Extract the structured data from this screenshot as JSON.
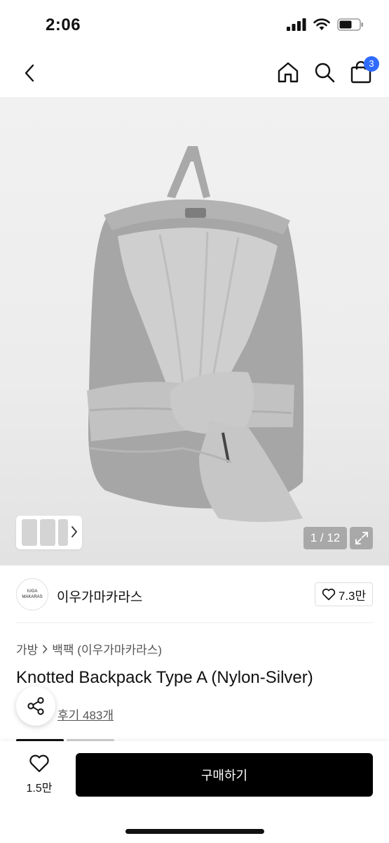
{
  "status_bar": {
    "time": "2:06"
  },
  "header": {
    "cart_count": "3"
  },
  "gallery": {
    "page_counter": "1 / 12"
  },
  "brand": {
    "logo_line1": "IUGA",
    "logo_line2": "MAKARAS",
    "name": "이우가마카라스",
    "likes": "7.3만"
  },
  "breadcrumb": {
    "category": "가방",
    "subcategory": "백팩 (이우가마카라스)"
  },
  "product": {
    "title": "Knotted Backpack Type A (Nylon-Silver)",
    "reviews": "후기 483개"
  },
  "bottom_bar": {
    "wish_count": "1.5만",
    "buy_label": "구매하기"
  }
}
